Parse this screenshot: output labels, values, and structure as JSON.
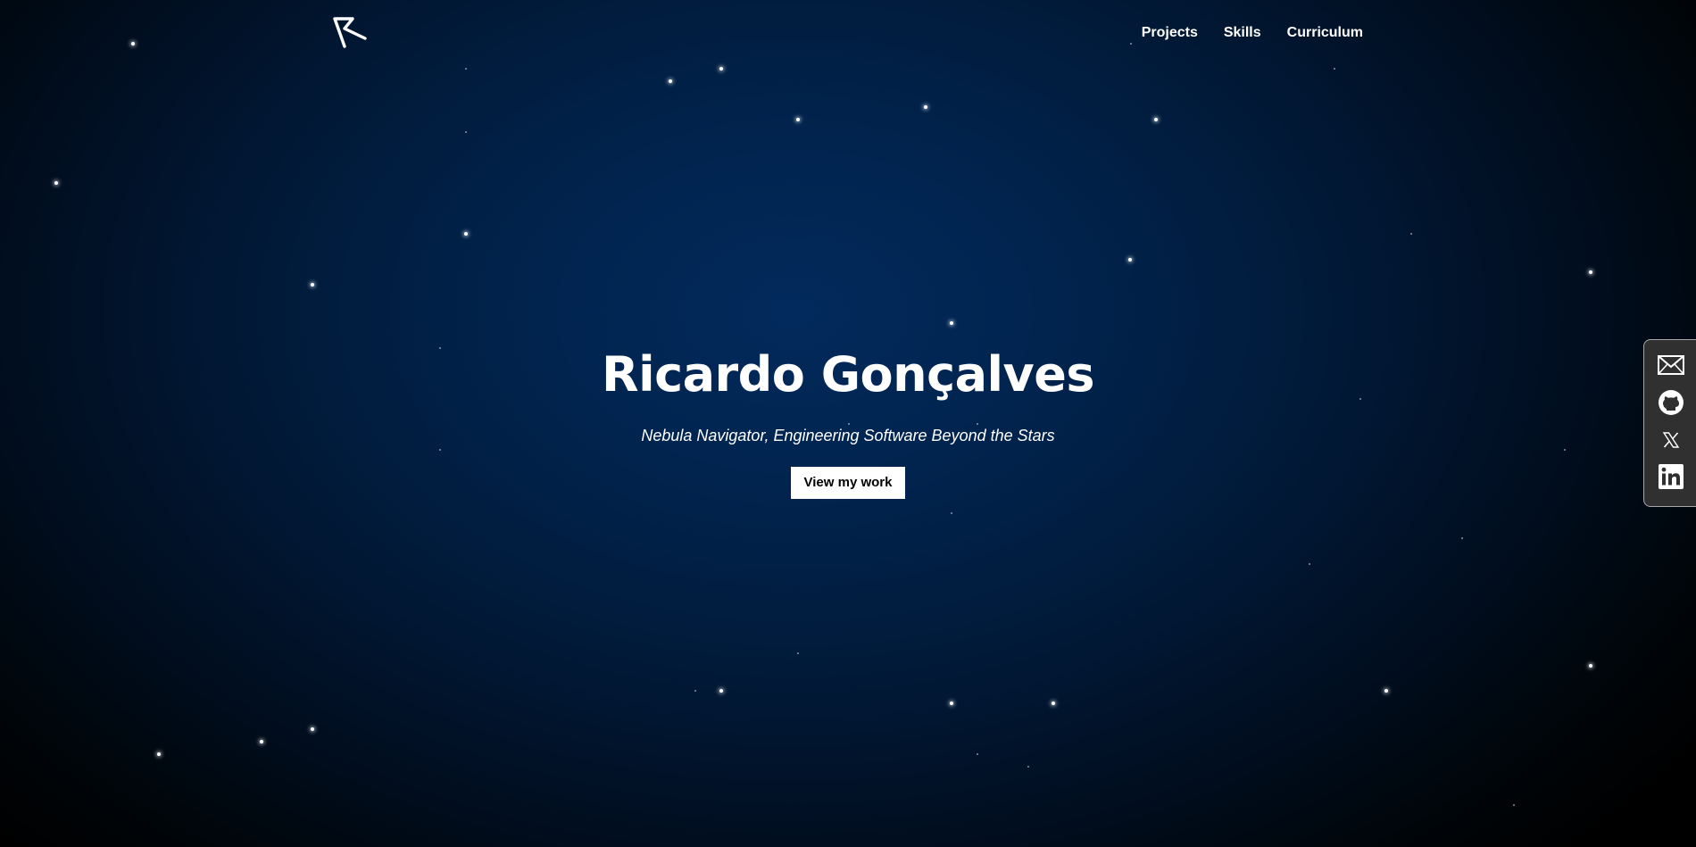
{
  "header": {
    "logo_icon": "r-arrow-logo-icon",
    "nav": [
      {
        "label": "Projects"
      },
      {
        "label": "Skills"
      },
      {
        "label": "Curriculum"
      }
    ]
  },
  "hero": {
    "name": "Ricardo Gonçalves",
    "tagline": "Nebula Navigator, Engineering Software Beyond the Stars",
    "cta_label": "View my work"
  },
  "social": [
    {
      "icon": "mail-icon"
    },
    {
      "icon": "github-icon"
    },
    {
      "icon": "x-twitter-icon"
    },
    {
      "icon": "linkedin-icon"
    }
  ],
  "colors": {
    "background_center": "#022a5c",
    "background_edge": "#000000",
    "text": "#ffffff",
    "button_bg": "#ffffff",
    "button_text": "#000000",
    "dock_bg": "#303030",
    "dock_border": "#a8a8a8"
  }
}
